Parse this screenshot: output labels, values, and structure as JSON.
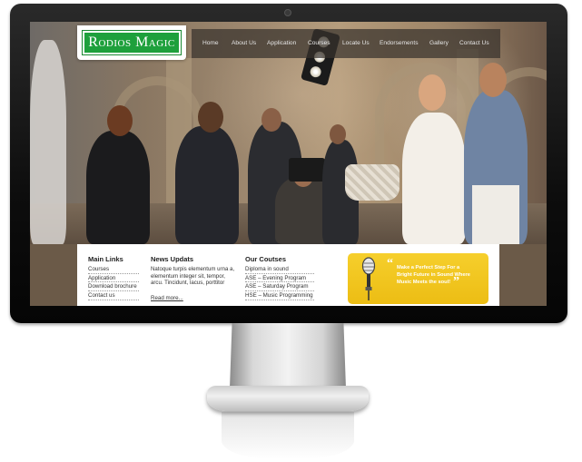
{
  "site": {
    "logo_text": "Rodios Magic"
  },
  "nav": {
    "items": [
      "Home",
      "About Us",
      "Application",
      "Courses",
      "Locate Us",
      "Endorsements",
      "Gallery",
      "Contact Us"
    ]
  },
  "footer_panel": {
    "main_links": {
      "heading": "Main Links",
      "items": [
        "Courses",
        "Application",
        "Download brochure",
        "Contact us"
      ]
    },
    "news": {
      "heading": "News Updats",
      "text": "Natoque turpis elementum urna a, elementum integer sit, tempor, arcu. Tincidunt, lacus, porttitor",
      "read_more": "Read more..."
    },
    "courses": {
      "heading": "Our Coutses",
      "items": [
        "Diploma in sound",
        "ASE – Evening Program",
        "ASE – Saturday Program",
        "HSE – Music Programming"
      ]
    },
    "promo": {
      "line1": "Make a Perfect Step For a",
      "line2": "Bright Future in  Sound Where",
      "line3": "Music Meets the soul!"
    }
  },
  "icons": {
    "microphone": "microphone-icon",
    "quote_open": "quote-open-icon",
    "quote_close": "quote-close-icon"
  }
}
